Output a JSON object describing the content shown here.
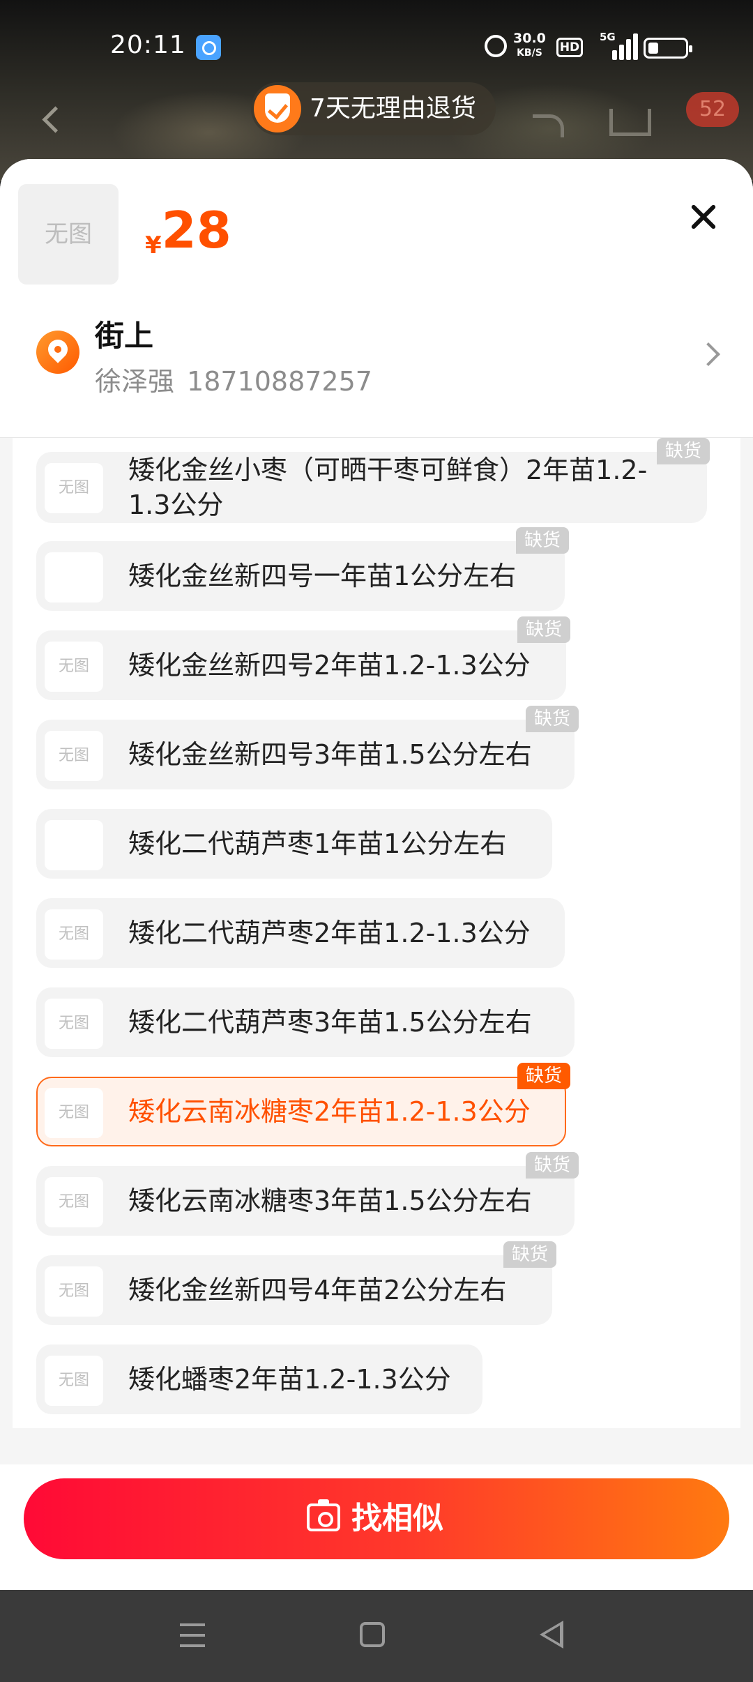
{
  "status_bar": {
    "time": "20:11",
    "speed_value": "30.0",
    "speed_unit": "KB/S",
    "hd": "HD",
    "network": "5G"
  },
  "header": {
    "guarantee": "7天无理由退货",
    "cart_count": "52"
  },
  "product": {
    "thumb_text": "无图",
    "currency": "¥",
    "price": "28"
  },
  "address": {
    "name": "街上",
    "recipient": "徐泽强",
    "phone": "18710887257"
  },
  "options": {
    "partial_label": "分左右",
    "stock_badge": "缺货",
    "no_image": "无图",
    "items": [
      {
        "label": "矮化金丝小枣（可晒干枣可鲜食）2年苗1.2-1.3公分",
        "badge": "缺货",
        "image": "无图",
        "selected": false
      },
      {
        "label": "矮化金丝新四号一年苗1公分左右",
        "badge": "缺货",
        "image": "photo-seedling",
        "selected": false
      },
      {
        "label": "矮化金丝新四号2年苗1.2-1.3公分",
        "badge": "缺货",
        "image": "无图",
        "selected": false
      },
      {
        "label": "矮化金丝新四号3年苗1.5公分左右",
        "badge": "缺货",
        "image": "无图",
        "selected": false
      },
      {
        "label": "矮化二代葫芦枣1年苗1公分左右",
        "badge": "",
        "image": "photo-gourd-jujube",
        "selected": false
      },
      {
        "label": "矮化二代葫芦枣2年苗1.2-1.3公分",
        "badge": "",
        "image": "无图",
        "selected": false
      },
      {
        "label": "矮化二代葫芦枣3年苗1.5公分左右",
        "badge": "",
        "image": "无图",
        "selected": false
      },
      {
        "label": "矮化云南冰糖枣2年苗1.2-1.3公分",
        "badge": "缺货",
        "image": "无图",
        "selected": true
      },
      {
        "label": "矮化云南冰糖枣3年苗1.5公分左右",
        "badge": "缺货",
        "image": "无图",
        "selected": false
      },
      {
        "label": "矮化金丝新四号4年苗2公分左右",
        "badge": "缺货",
        "image": "无图",
        "selected": false
      },
      {
        "label": "矮化蟠枣2年苗1.2-1.3公分",
        "badge": "",
        "image": "无图",
        "selected": false
      }
    ]
  },
  "action": {
    "find_similar": "找相似"
  },
  "colors": {
    "accent": "#ff5000",
    "button_start": "#ff0a36",
    "button_end": "#ff7a10",
    "badge_gray": "#cfcfcf"
  },
  "icons": [
    "back-icon",
    "shield-check-icon",
    "share-icon",
    "cart-icon",
    "close-icon",
    "location-pin-icon",
    "chevron-right-icon",
    "camera-icon",
    "menu-icon",
    "home-icon",
    "back-triangle-icon"
  ]
}
